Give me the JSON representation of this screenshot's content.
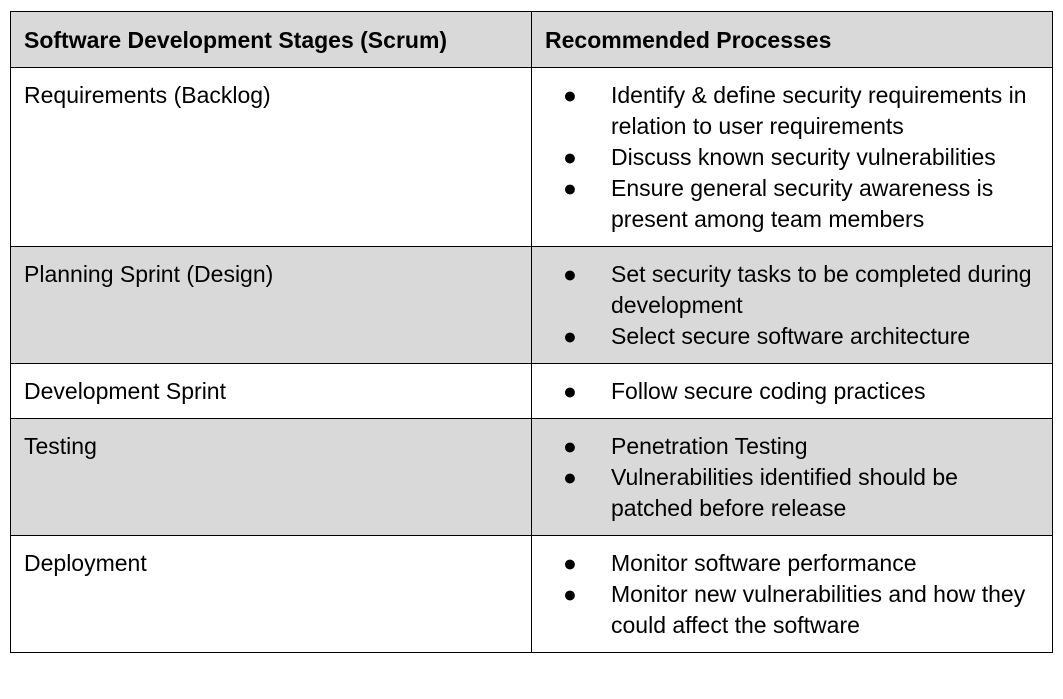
{
  "table": {
    "headers": [
      "Software Development Stages (Scrum)",
      "Recommended Processes"
    ],
    "rows": [
      {
        "stage": "Requirements (Backlog)",
        "processes": [
          "Identify & define security requirements in relation to user requirements",
          "Discuss known security vulnerabilities",
          "Ensure general security awareness is present among team members"
        ]
      },
      {
        "stage": "Planning Sprint (Design)",
        "processes": [
          "Set security tasks to be completed during development",
          "Select secure software architecture"
        ]
      },
      {
        "stage": "Development Sprint",
        "processes": [
          "Follow secure coding practices"
        ]
      },
      {
        "stage": "Testing",
        "processes": [
          "Penetration Testing",
          "Vulnerabilities identified should be patched before release"
        ]
      },
      {
        "stage": "Deployment",
        "processes": [
          "Monitor software performance",
          "Monitor new vulnerabilities and how they could affect the software"
        ]
      }
    ],
    "bullet_glyph": "●",
    "colors": {
      "header_bg": "#d9d9d9",
      "shaded_row_bg": "#d9d9d9",
      "border": "#000000"
    }
  }
}
